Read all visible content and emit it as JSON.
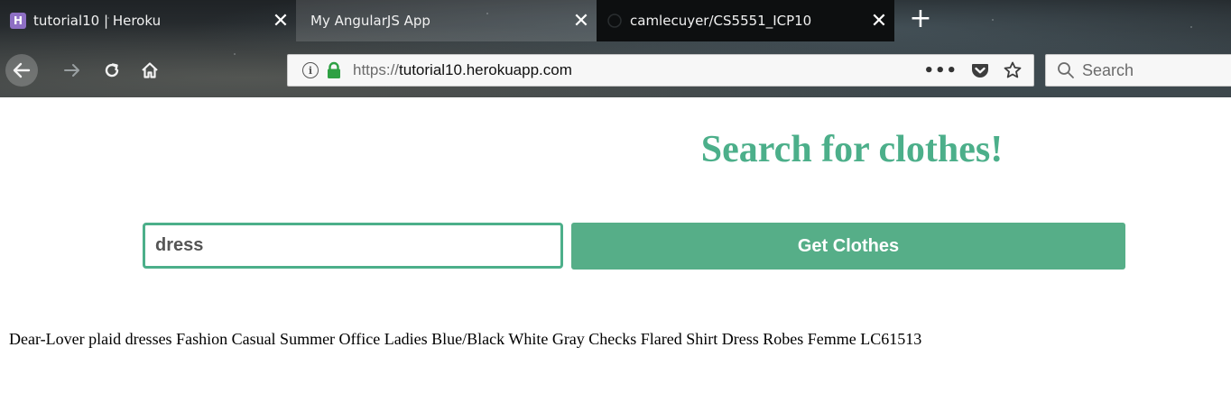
{
  "browser": {
    "tabs": [
      {
        "title": "tutorial10 | Heroku",
        "favicon": "heroku-icon",
        "active": false
      },
      {
        "title": "My AngularJS App",
        "favicon": "",
        "active": true
      },
      {
        "title": "camlecuyer/CS5551_ICP10",
        "favicon": "github-icon",
        "active": false
      }
    ],
    "tab_close_glyph": "✕",
    "new_tab_glyph": "+",
    "url": {
      "scheme": "https://",
      "domain": "tutorial10.herokuapp.com"
    },
    "info_glyph": "i",
    "page_actions_glyph": "•••",
    "search_placeholder": "Search"
  },
  "page": {
    "title": "Search for clothes!",
    "query_value": "dress",
    "button_label": "Get Clothes",
    "result": "Dear-Lover plaid dresses Fashion Casual Summer Office Ladies Blue/Black White Gray Checks Flared Shirt Dress Robes Femme LC61513"
  },
  "colors": {
    "accent": "#4caf8a",
    "button": "#56ae88",
    "lock_green": "#2ea043",
    "heroku_purple": "#8e6fc4"
  }
}
